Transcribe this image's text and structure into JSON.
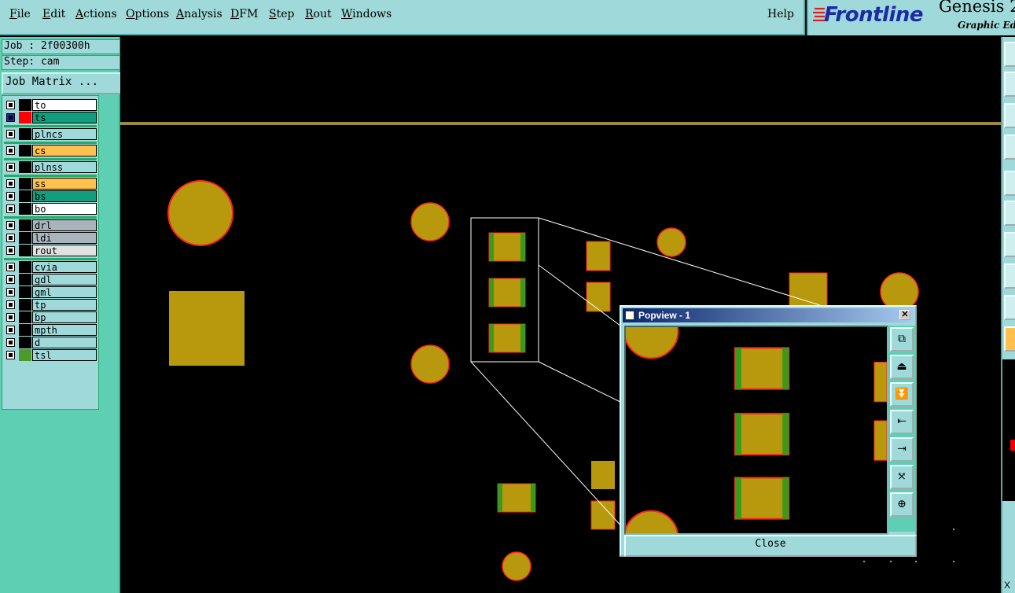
{
  "menubar": {
    "items": [
      "File",
      "Edit",
      "Actions",
      "Options",
      "Analysis",
      "DFM",
      "Step",
      "Rout",
      "Windows"
    ],
    "help": "Help"
  },
  "brand": {
    "logo": "Frontline",
    "title": "Genesis 2",
    "subtitle": "Graphic Edit"
  },
  "job": {
    "job_line": "Job : 2f00300h",
    "step_line": "Step: cam"
  },
  "job_matrix_label": "Job Matrix ...",
  "layers": [
    {
      "name": "to",
      "color": "#000000",
      "bg": "#ffffff"
    },
    {
      "name": "ts",
      "color": "#ff0000",
      "bg": "#129e7c",
      "selected": true
    },
    {
      "name": "plncs",
      "color": "#000000",
      "bg": "#9fd9d9"
    },
    {
      "name": "cs",
      "color": "#000000",
      "bg": "#ffc04d"
    },
    {
      "name": "plnss",
      "color": "#000000",
      "bg": "#9fd9d9"
    },
    {
      "name": "ss",
      "color": "#000000",
      "bg": "#ffc04d"
    },
    {
      "name": "bs",
      "color": "#000000",
      "bg": "#129e7c"
    },
    {
      "name": "bo",
      "color": "#000000",
      "bg": "#ffffff"
    },
    {
      "name": "drl",
      "color": "#000000",
      "bg": "#a9b4bd"
    },
    {
      "name": "ldi",
      "color": "#000000",
      "bg": "#a9b4bd"
    },
    {
      "name": "rout",
      "color": "#000000",
      "bg": "#e1e1e1"
    },
    {
      "name": "cvia",
      "color": "#000000",
      "bg": "#9fd9d9"
    },
    {
      "name": "gdl",
      "color": "#000000",
      "bg": "#9fd9d9"
    },
    {
      "name": "gml",
      "color": "#000000",
      "bg": "#9fd9d9"
    },
    {
      "name": "tp",
      "color": "#000000",
      "bg": "#9fd9d9"
    },
    {
      "name": "bp",
      "color": "#000000",
      "bg": "#9fd9d9"
    },
    {
      "name": "mpth",
      "color": "#000000",
      "bg": "#9fd9d9"
    },
    {
      "name": "d",
      "color": "#000000",
      "bg": "#9fd9d9"
    },
    {
      "name": "tsl",
      "color": "#4c9a2a",
      "bg": "#9fd9d9"
    }
  ],
  "popview": {
    "title": "Popview - 1",
    "close_label": "Close",
    "tool_icons": [
      "zoom-window-icon",
      "pan-up-icon",
      "pan-down-icon",
      "pan-left-icon",
      "pan-right-icon",
      "zoom-out-icon",
      "zoom-in-icon"
    ]
  },
  "colors": {
    "pad_fill": "#b8980c",
    "pad_outline": "#ff2020",
    "pad_side": "#3a9a1c",
    "trace": "#a08a3a",
    "panel_bg": "#9fd9d9",
    "panel_accent": "#5fcfb4"
  },
  "corner_marker": "X"
}
